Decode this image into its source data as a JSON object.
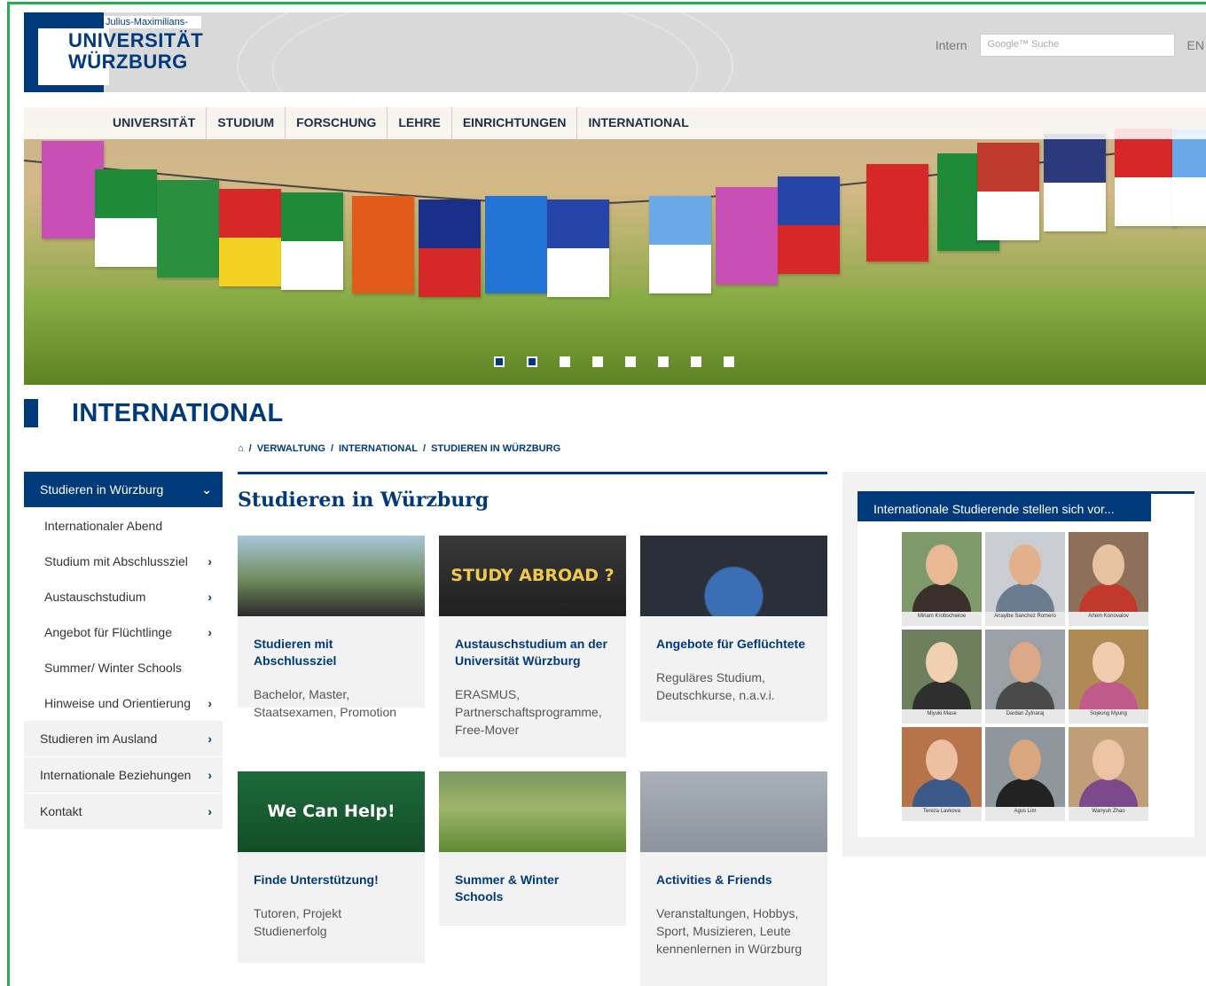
{
  "header": {
    "logo_small": "Julius-Maximilians-",
    "logo_line1": "UNIVERSITÄT",
    "logo_line2": "WÜRZBURG",
    "intern": "Intern",
    "search_placeholder": "Google™ Suche",
    "lang": "EN"
  },
  "nav": [
    "UNIVERSITÄT",
    "STUDIUM",
    "FORSCHUNG",
    "LEHRE",
    "EINRICHTUNGEN",
    "INTERNATIONAL"
  ],
  "banner": {
    "slides": 8,
    "active_slides": [
      0,
      1
    ]
  },
  "section_title": "INTERNATIONAL",
  "breadcrumb": [
    "VERWALTUNG",
    "INTERNATIONAL",
    "STUDIEREN IN WÜRZBURG"
  ],
  "page_title": "Studieren in Würzburg",
  "sidebar": [
    {
      "label": "Studieren in Würzburg",
      "active": true,
      "chevron": "⌄"
    },
    {
      "label": "Internationaler Abend",
      "sub": true
    },
    {
      "label": "Studium mit Abschlussziel",
      "sub": true,
      "chevron": "›"
    },
    {
      "label": "Austauschstudium",
      "sub": true,
      "chevron": "›"
    },
    {
      "label": "Angebot für Flüchtlinge",
      "sub": true,
      "chevron": "›"
    },
    {
      "label": "Summer/ Winter Schools",
      "sub": true
    },
    {
      "label": "Hinweise und Orientierung",
      "sub": true,
      "chevron": "›"
    },
    {
      "label": "Studieren im Ausland",
      "chevron": "›"
    },
    {
      "label": "Internationale Beziehungen",
      "chevron": "›"
    },
    {
      "label": "Kontakt",
      "chevron": "›"
    }
  ],
  "cards": [
    {
      "title": "Studieren mit Abschlussziel",
      "text": "Bachelor, Master, Staatsexamen, Promotion",
      "img_text": ""
    },
    {
      "title": "Austauschstudium an der Universität Würzburg",
      "text": "ERASMUS, Partnerschaftsprogramme, Free-Mover",
      "img_text": "STUDY ABROAD ?"
    },
    {
      "title": "Angebote für Geflüchtete",
      "text": "Reguläres Studium, Deutschkurse, n.a.v.i.",
      "img_text": ""
    },
    {
      "title": "Finde Unterstützung!",
      "text": "Tutoren, Projekt Studienerfolg",
      "img_text": "We Can Help!"
    },
    {
      "title": "Summer & Winter Schools",
      "text": "",
      "img_text": ""
    },
    {
      "title": "Activities & Friends",
      "text": "Veranstaltungen, Hobbys, Sport, Musizieren, Leute kennenlernen in Würzburg",
      "img_text": ""
    }
  ],
  "right_panel": {
    "title": "Internationale Studierende stellen sich vor...",
    "people": [
      "Miriam Krobschieloe",
      "Anayibe Sanchez Romero",
      "Artem Konovalov",
      "Miyuki Mase",
      "Dardan Zylnaraj",
      "Sojeong Myung",
      "Tereza Lavkova",
      "Agus Lim",
      "Wanyuh Zhao"
    ]
  },
  "colors": {
    "primary": "#003a7a",
    "panel": "#f2f2f2",
    "frame": "#1fb14a"
  }
}
